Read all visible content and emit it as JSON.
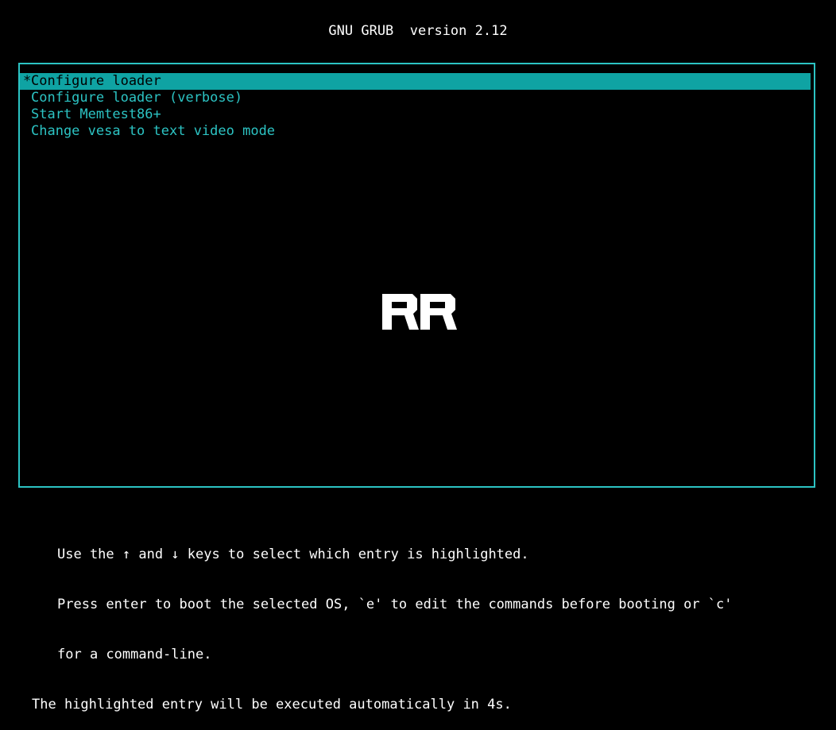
{
  "header": {
    "title": "GNU GRUB  version 2.12"
  },
  "menu": {
    "selected_marker": "*",
    "entries": [
      {
        "label": "Configure loader",
        "selected": true
      },
      {
        "label": "Configure loader (verbose)",
        "selected": false
      },
      {
        "label": "Start Memtest86+",
        "selected": false
      },
      {
        "label": "Change vesa to text video mode",
        "selected": false
      }
    ]
  },
  "logo": {
    "text": "RR"
  },
  "help": {
    "line1": "Use the ↑ and ↓ keys to select which entry is highlighted.",
    "line2": "Press enter to boot the selected OS, `e' to edit the commands before booting or `c'",
    "line3": "for a command-line.",
    "countdown": "The highlighted entry will be executed automatically in 4s."
  },
  "colors": {
    "background": "#000000",
    "border": "#2cc3c3",
    "highlight": "#0fa3a3",
    "text": "#ffffff"
  }
}
